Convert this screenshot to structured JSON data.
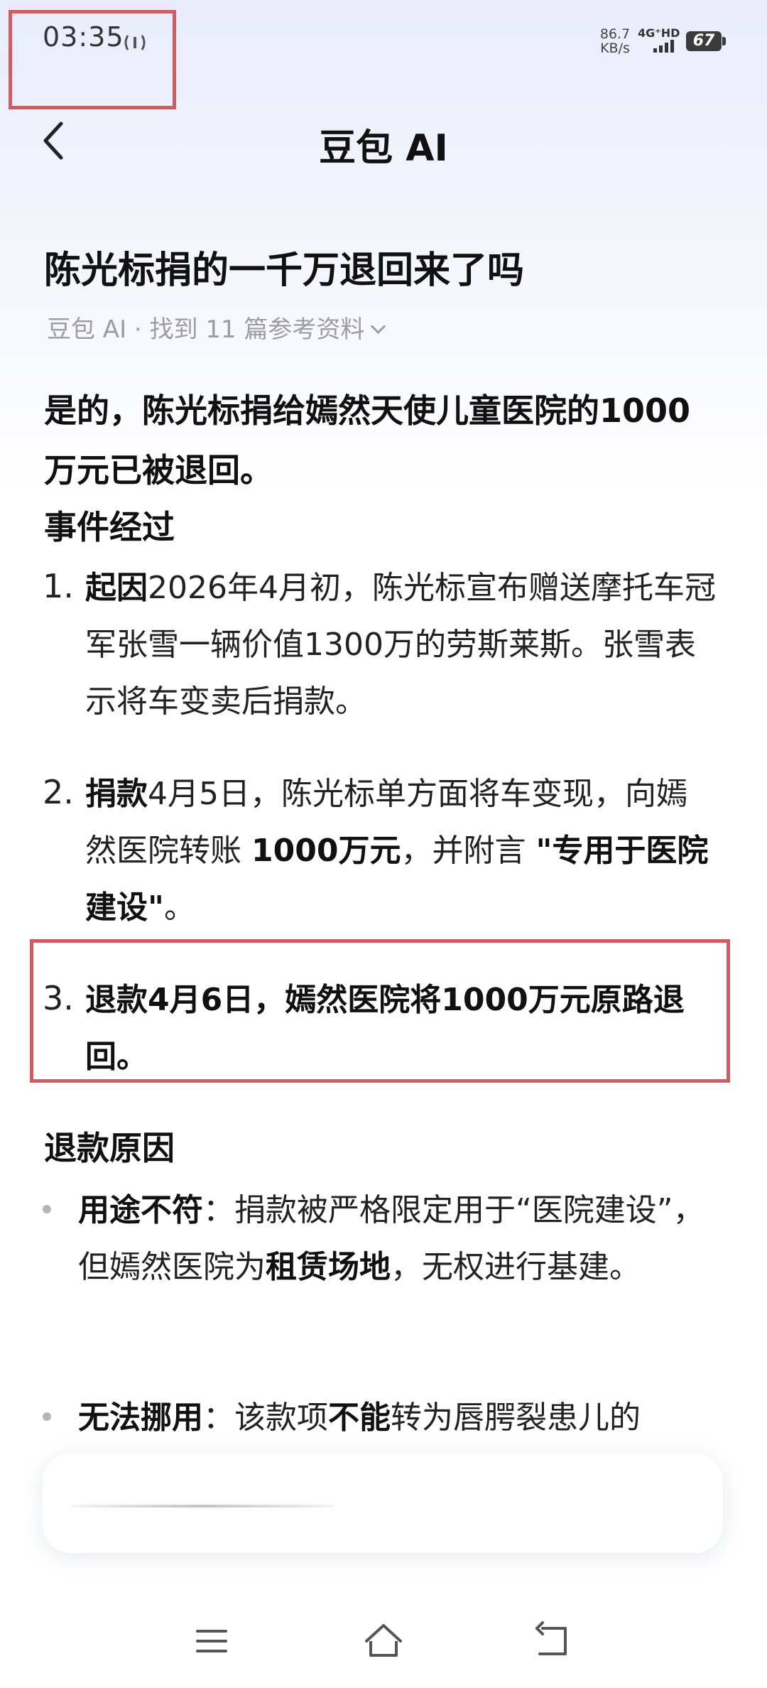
{
  "status_bar": {
    "time": "03:35",
    "net_speed_value": "86.7",
    "net_speed_unit": "KB/s",
    "network_type": "4G⁺HD",
    "battery": "67"
  },
  "header": {
    "back_icon": "chevron-left-icon",
    "title": "豆包 AI"
  },
  "conversation": {
    "question": "陈光标捐的一千万退回来了吗",
    "source_line": "豆包 AI · 找到 11 篇参考资料",
    "answer_summary": "是的，陈光标捐给嫣然天使儿童医院的1000万元已被退回。",
    "events_heading": "事件经过",
    "events": [
      {
        "number": "1.",
        "title": "起因",
        "text": "2026年4月初，陈光标宣布赠送摩托车冠军张雪一辆价值1300万的劳斯莱斯。张雪表示将车变卖后捐款。"
      },
      {
        "number": "2.",
        "title": "捐款",
        "text_a": "4月5日，陈光标单方面将车变现，向嫣然医院转账 ",
        "text_b": "1000万元",
        "text_c": "，并附言 ",
        "text_d": "\"专用于医院建设\"",
        "text_e": "。"
      },
      {
        "number": "3.",
        "text": "退款4月6日，嫣然医院将1000万元原路退回。"
      }
    ],
    "reasons_heading": "退款原因",
    "reasons": [
      {
        "title": "用途不符",
        "text_a": "：捐款被严格限定用于“医院建设”，但嫣然医院为",
        "text_b": "租赁场地",
        "text_c": "，无权进行基建。"
      },
      {
        "title": "无法挪用",
        "text_a": "：该款项",
        "text_b": "不能",
        "text_c": "转为唇腭裂患儿的"
      }
    ]
  },
  "nav": {
    "menu_icon": "menu-icon",
    "home_icon": "home-icon",
    "back_icon": "back-icon"
  },
  "colors": {
    "highlight": "#cf5b64",
    "muted_text": "#9a9ca6"
  }
}
